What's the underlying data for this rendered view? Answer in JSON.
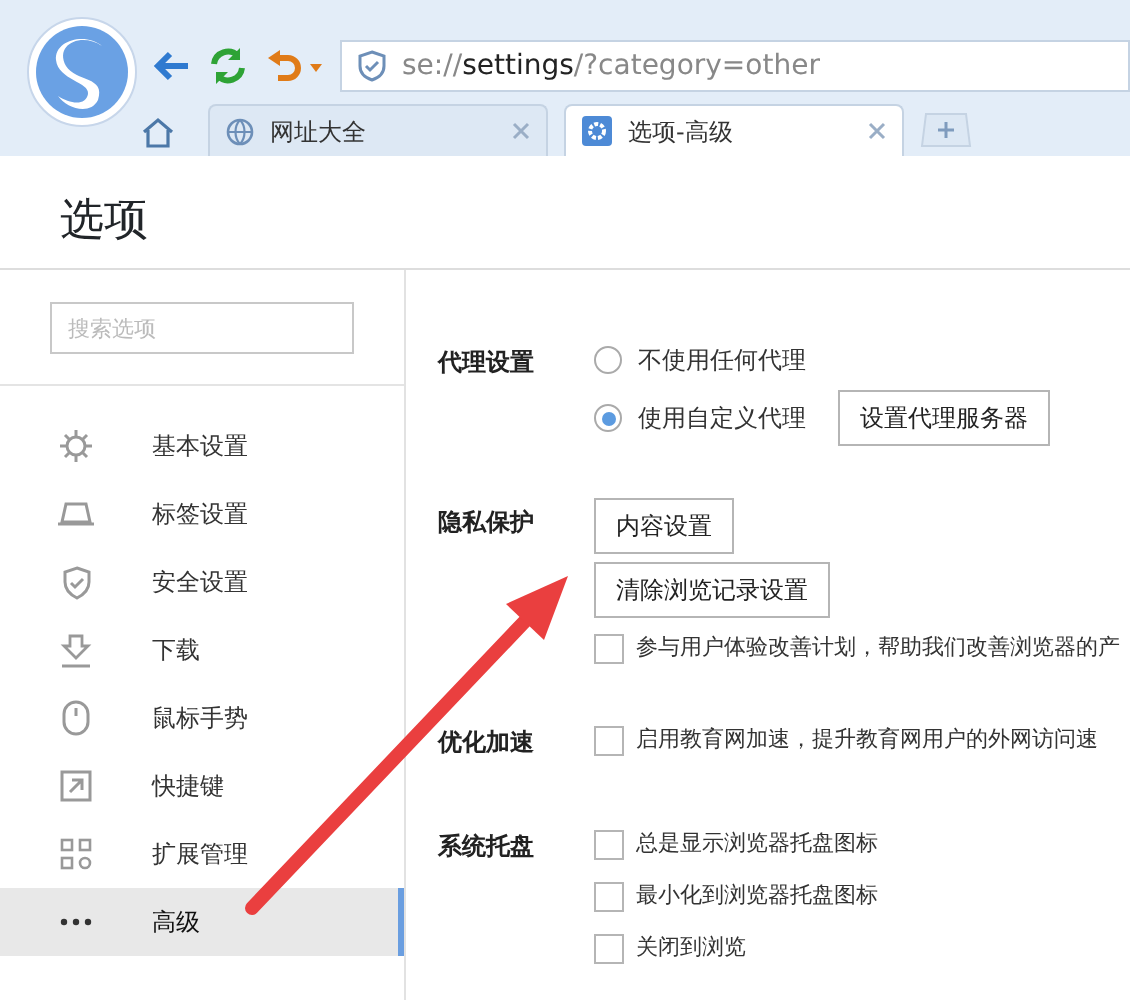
{
  "address_bar": {
    "scheme": "se://",
    "host": "settings",
    "path": "/?category=other"
  },
  "tabs": [
    {
      "label": "网址大全",
      "selected": false
    },
    {
      "label": "选项-高级",
      "selected": true
    }
  ],
  "page_title": "选项",
  "search": {
    "placeholder": "搜索选项"
  },
  "sidebar": {
    "items": [
      {
        "label": "基本设置",
        "selected": false
      },
      {
        "label": "标签设置",
        "selected": false
      },
      {
        "label": "安全设置",
        "selected": false
      },
      {
        "label": "下载",
        "selected": false
      },
      {
        "label": "鼠标手势",
        "selected": false
      },
      {
        "label": "快捷键",
        "selected": false
      },
      {
        "label": "扩展管理",
        "selected": false
      },
      {
        "label": "高级",
        "selected": true
      }
    ]
  },
  "sections": [
    {
      "label": "代理设置",
      "rows": [
        [
          {
            "kind": "radio",
            "label": "不使用任何代理",
            "selected": false
          }
        ],
        [
          {
            "kind": "radio",
            "label": "使用自定义代理",
            "selected": true
          },
          {
            "kind": "button",
            "label": "设置代理服务器"
          }
        ]
      ]
    },
    {
      "label": "隐私保护",
      "rows": [
        [
          {
            "kind": "button",
            "label": "内容设置"
          }
        ],
        [
          {
            "kind": "button",
            "label": "清除浏览记录设置"
          }
        ],
        [
          {
            "kind": "checkbox",
            "label": "参与用户体验改善计划，帮助我们改善浏览器的产",
            "checked": false
          }
        ]
      ]
    },
    {
      "label": "优化加速",
      "rows": [
        [
          {
            "kind": "checkbox",
            "label": "启用教育网加速，提升教育网用户的外网访问速",
            "checked": false
          }
        ]
      ]
    },
    {
      "label": "系统托盘",
      "rows": [
        [
          {
            "kind": "checkbox",
            "label": "总是显示浏览器托盘图标",
            "checked": false
          }
        ],
        [
          {
            "kind": "checkbox",
            "label": "最小化到浏览器托盘图标",
            "checked": false
          }
        ],
        [
          {
            "kind": "checkbox",
            "label": "关闭到浏览",
            "checked": false
          }
        ]
      ]
    }
  ]
}
